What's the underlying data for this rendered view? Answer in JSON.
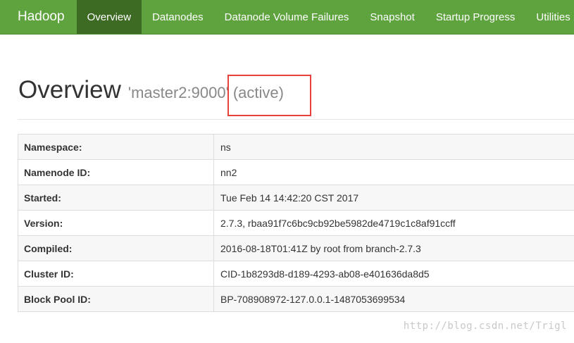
{
  "navbar": {
    "brand": "Hadoop",
    "items": [
      {
        "label": "Overview",
        "active": true
      },
      {
        "label": "Datanodes",
        "active": false
      },
      {
        "label": "Datanode Volume Failures",
        "active": false
      },
      {
        "label": "Snapshot",
        "active": false
      },
      {
        "label": "Startup Progress",
        "active": false
      },
      {
        "label": "Utilities",
        "active": false
      }
    ],
    "bg_color": "#5fa33e",
    "active_color": "#3d6b24"
  },
  "page": {
    "title": "Overview",
    "host": "'master2:9000'",
    "state": "(active)",
    "highlight_color": "#e8413d"
  },
  "info_table": [
    {
      "label": "Namespace:",
      "value": "ns"
    },
    {
      "label": "Namenode ID:",
      "value": "nn2"
    },
    {
      "label": "Started:",
      "value": "Tue Feb 14 14:42:20 CST 2017"
    },
    {
      "label": "Version:",
      "value": "2.7.3, rbaa91f7c6bc9cb92be5982de4719c1c8af91ccff"
    },
    {
      "label": "Compiled:",
      "value": "2016-08-18T01:41Z by root from branch-2.7.3"
    },
    {
      "label": "Cluster ID:",
      "value": "CID-1b8293d8-d189-4293-ab08-e401636da8d5"
    },
    {
      "label": "Block Pool ID:",
      "value": "BP-708908972-127.0.0.1-1487053699534"
    }
  ],
  "watermark": "http://blog.csdn.net/Trigl"
}
